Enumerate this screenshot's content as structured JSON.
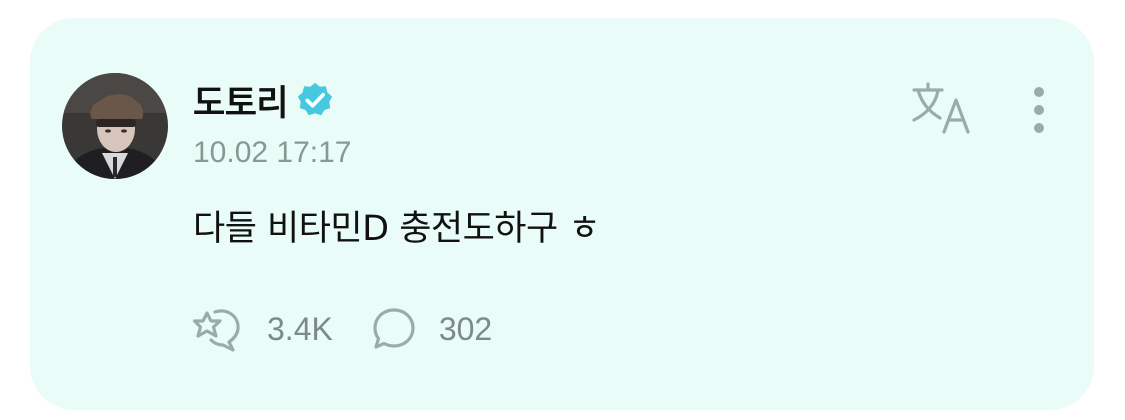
{
  "post": {
    "author": "도토리",
    "verified": true,
    "timestamp": "10.02 17:17",
    "text": "다들 비타민D 충전도하구 ㅎ",
    "reactions": {
      "icon": "reaction-icon",
      "count": "3.4K"
    },
    "comments": {
      "icon": "comment-icon",
      "count": "302"
    }
  },
  "actions": {
    "translate_icon": "translate-icon",
    "more_icon": "more-vertical-icon"
  },
  "colors": {
    "card_background": "#e9fcf7",
    "verified_badge": "#46c8e0",
    "muted_icon": "#9aaca8"
  }
}
